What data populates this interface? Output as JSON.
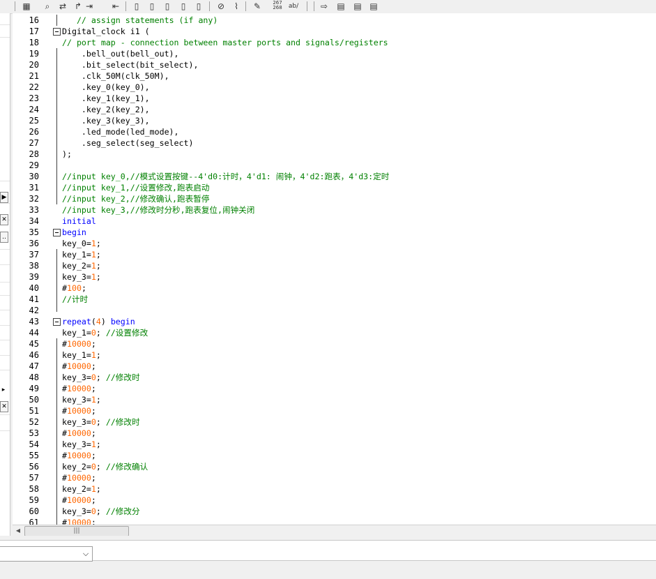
{
  "toolbar": {
    "icons": [
      "stamp-icon",
      "find-icon",
      "replace-icon",
      "goto-icon",
      "indent-icon",
      "outdent-icon",
      "bookmark-icon",
      "bookmark-next-icon",
      "bookmark-prev-icon",
      "bookmark-clear-icon",
      "bookmark-list-icon",
      "attach-icon",
      "scroll-icon",
      "edit-icon",
      "insert-number-icon",
      "spell-icon",
      "jump-icon",
      "doc-icon",
      "doc2-icon",
      "doc3-icon"
    ],
    "number_label_top": "267",
    "number_label_bottom": "268",
    "ab_label": "ab/"
  },
  "left_panel": {
    "btn_play": "▶",
    "btn_close_1": "✕",
    "btn_dots": "..",
    "btn_arrow": "▸",
    "btn_close_2": "✕"
  },
  "editor": {
    "lines": [
      {
        "n": "16",
        "text": "   // assign statements (if any)"
      },
      {
        "n": "17",
        "text": "Digital_clock i1 ("
      },
      {
        "n": "18",
        "text": "// port map - connection between master ports and signals/registers"
      },
      {
        "n": "19",
        "text": "    .bell_out(bell_out),"
      },
      {
        "n": "20",
        "text": "    .bit_select(bit_select),"
      },
      {
        "n": "21",
        "text": "    .clk_50M(clk_50M),"
      },
      {
        "n": "22",
        "text": "    .key_0(key_0),"
      },
      {
        "n": "23",
        "text": "    .key_1(key_1),"
      },
      {
        "n": "24",
        "text": "    .key_2(key_2),"
      },
      {
        "n": "25",
        "text": "    .key_3(key_3),"
      },
      {
        "n": "26",
        "text": "    .led_mode(led_mode),"
      },
      {
        "n": "27",
        "text": "    .seg_select(seg_select)"
      },
      {
        "n": "28",
        "text": ");"
      },
      {
        "n": "29",
        "text": ""
      },
      {
        "n": "30",
        "text": "//input key_0,//模式设置按键--4'd0:计时，4'd1: 闹钟，4'd2:跑表，4'd3:定时"
      },
      {
        "n": "31",
        "text": "//input key_1,//设置修改,跑表启动"
      },
      {
        "n": "32",
        "text": "//input key_2,//修改确认,跑表暂停"
      },
      {
        "n": "33",
        "text": "//input key_3,//修改时分秒,跑表复位,闹钟关闭"
      },
      {
        "n": "34",
        "text": "initial"
      },
      {
        "n": "35",
        "text": "begin"
      },
      {
        "n": "36",
        "text": "key_0=1;"
      },
      {
        "n": "37",
        "text": "key_1=1;"
      },
      {
        "n": "38",
        "text": "key_2=1;"
      },
      {
        "n": "39",
        "text": "key_3=1;"
      },
      {
        "n": "40",
        "text": "#100;"
      },
      {
        "n": "41",
        "text": "//计时"
      },
      {
        "n": "42",
        "text": ""
      },
      {
        "n": "43",
        "text": "repeat(4) begin"
      },
      {
        "n": "44",
        "text": "key_1=0; //设置修改"
      },
      {
        "n": "45",
        "text": "#10000;"
      },
      {
        "n": "46",
        "text": "key_1=1;"
      },
      {
        "n": "47",
        "text": "#10000;"
      },
      {
        "n": "48",
        "text": "key_3=0; //修改时"
      },
      {
        "n": "49",
        "text": "#10000;"
      },
      {
        "n": "50",
        "text": "key_3=1;"
      },
      {
        "n": "51",
        "text": "#10000;"
      },
      {
        "n": "52",
        "text": "key_3=0; //修改时"
      },
      {
        "n": "53",
        "text": "#10000;"
      },
      {
        "n": "54",
        "text": "key_3=1;"
      },
      {
        "n": "55",
        "text": "#10000;"
      },
      {
        "n": "56",
        "text": "key_2=0; //修改确认"
      },
      {
        "n": "57",
        "text": "#10000;"
      },
      {
        "n": "58",
        "text": "key_2=1;"
      },
      {
        "n": "59",
        "text": "#10000;"
      },
      {
        "n": "60",
        "text": "key_3=0; //修改分"
      },
      {
        "n": "61",
        "text": "#10000;"
      }
    ]
  },
  "hscroll": {
    "left_arrow": "◀",
    "thumb_grip": "|||"
  },
  "bottom": {
    "dropdown_value": "",
    "dropdown_arrow": "⌵"
  }
}
